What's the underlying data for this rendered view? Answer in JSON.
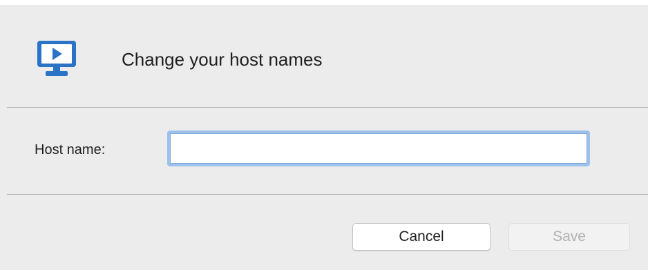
{
  "dialog": {
    "title": "Change your host names",
    "icon": "monitor-play-icon",
    "accent_color": "#2a73c7"
  },
  "form": {
    "host_name_label": "Host name:",
    "host_name_value": "",
    "focus_ring_color": "#9dc1ea"
  },
  "actions": {
    "cancel_label": "Cancel",
    "save_label": "Save",
    "save_enabled": false
  }
}
